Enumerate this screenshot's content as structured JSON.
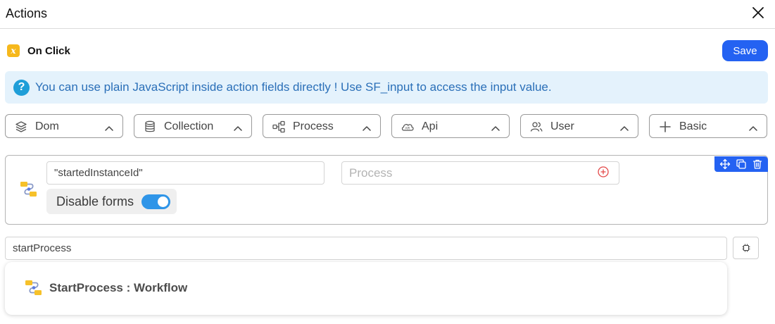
{
  "header": {
    "title": "Actions",
    "close_icon": "close-icon"
  },
  "event": {
    "icon": "variable-x-icon",
    "label": "On Click"
  },
  "toolbar": {
    "save_label": "Save"
  },
  "info": {
    "icon": "question-circle-icon",
    "text": "You can use plain JavaScript inside action fields directly ! Use SF_input to access the input value."
  },
  "categories": [
    {
      "label": "Dom",
      "icon": "layers-icon"
    },
    {
      "label": "Collection",
      "icon": "database-icon"
    },
    {
      "label": "Process",
      "icon": "process-flow-icon"
    },
    {
      "label": "Api",
      "icon": "cloud-api-icon"
    },
    {
      "label": "User",
      "icon": "users-icon"
    },
    {
      "label": "Basic",
      "icon": "plus-icon"
    }
  ],
  "action_card": {
    "icon": "workflow-icon",
    "key_value": "\"startedInstanceId\"",
    "process_placeholder": "Process",
    "process_value": "",
    "disable_forms_label": "Disable forms",
    "disable_forms_enabled": true,
    "tools": [
      "move-icon",
      "copy-icon",
      "trash-icon"
    ]
  },
  "search": {
    "value": "startProcess"
  },
  "suggestions": [
    {
      "label": "StartProcess : Workflow",
      "icon": "workflow-icon"
    }
  ],
  "colors": {
    "primary": "#2462f2",
    "info_bg": "#e4f2fc",
    "info_text": "#2a6fb8",
    "toggle_on": "#2f95e8",
    "accent_yellow": "#f6b81c"
  }
}
